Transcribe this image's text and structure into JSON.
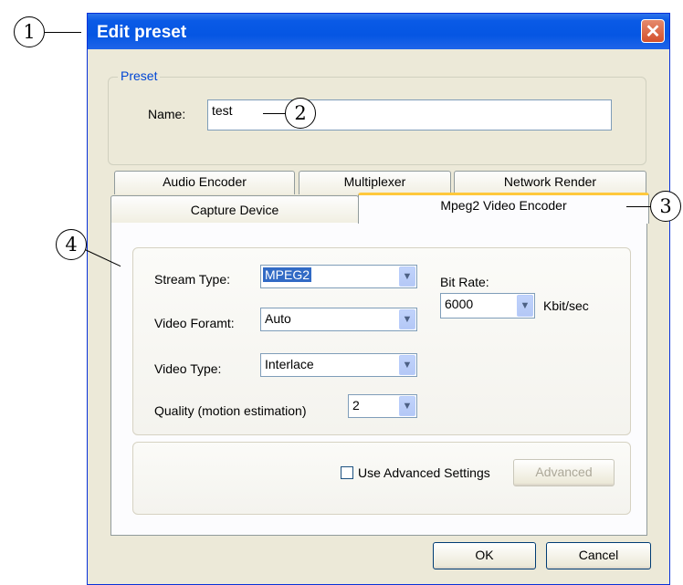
{
  "callouts": [
    "1",
    "2",
    "3",
    "4"
  ],
  "dialog": {
    "title": "Edit preset",
    "close_symbol": "✕"
  },
  "preset_group": {
    "legend": "Preset",
    "name_label": "Name:",
    "name_value": "test"
  },
  "tabs": {
    "row_back": [
      "Audio Encoder",
      "Multiplexer",
      "Network Render"
    ],
    "row_front": [
      "Capture Device",
      "Mpeg2 Video Encoder"
    ],
    "active": "Mpeg2 Video Encoder"
  },
  "encoder": {
    "stream_type_label": "Stream Type:",
    "stream_type_value": "MPEG2",
    "video_format_label": "Video Foramt:",
    "video_format_value": "Auto",
    "video_type_label": "Video Type:",
    "video_type_value": "Interlace",
    "quality_label": "Quality (motion estimation)",
    "quality_value": "2",
    "bit_rate_label": "Bit Rate:",
    "bit_rate_value": "6000",
    "bit_rate_unit": "Kbit/sec"
  },
  "advanced": {
    "checkbox_label": "Use Advanced Settings",
    "checked": false,
    "button_label": "Advanced"
  },
  "footer": {
    "ok_label": "OK",
    "cancel_label": "Cancel"
  },
  "icons": {
    "dropdown_arrow": "chevron-down-icon",
    "close": "close-icon"
  }
}
